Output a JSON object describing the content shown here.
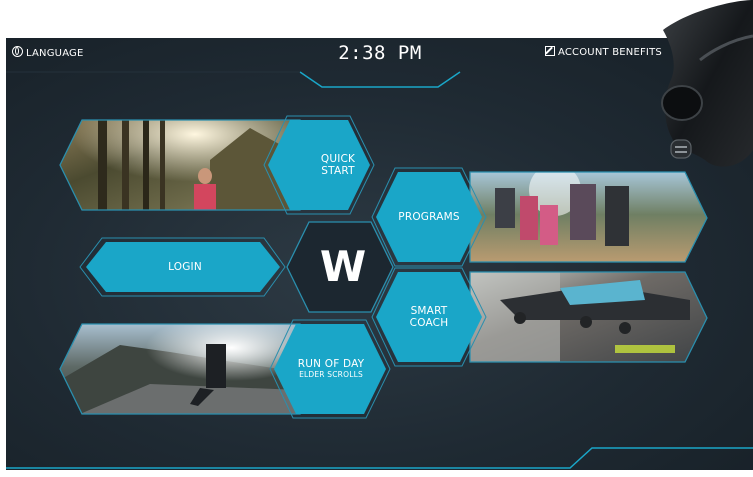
{
  "header": {
    "language_label": "LANGUAGE",
    "time": "2:38 PM",
    "account_label": "ACCOUNT BENEFITS"
  },
  "tiles": {
    "quick_start": {
      "line1": "QUICK",
      "line2": "START"
    },
    "programs": {
      "label": "PROGRAMS"
    },
    "login": {
      "label": "LOGIN"
    },
    "smart_coach": {
      "line1": "SMART",
      "line2": "COACH"
    },
    "run_of_day": {
      "line1": "RUN OF DAY",
      "line2": "ELDER SCROLLS"
    }
  },
  "logo": {
    "letter": "W"
  },
  "colors": {
    "accent": "#1aa6c8",
    "accent_dark": "#1586a3",
    "screen_bg": "#202b34",
    "outline": "#2a8fae",
    "text": "#ffffff"
  },
  "icons": {
    "language": "globe-icon",
    "account": "edit-icon"
  }
}
